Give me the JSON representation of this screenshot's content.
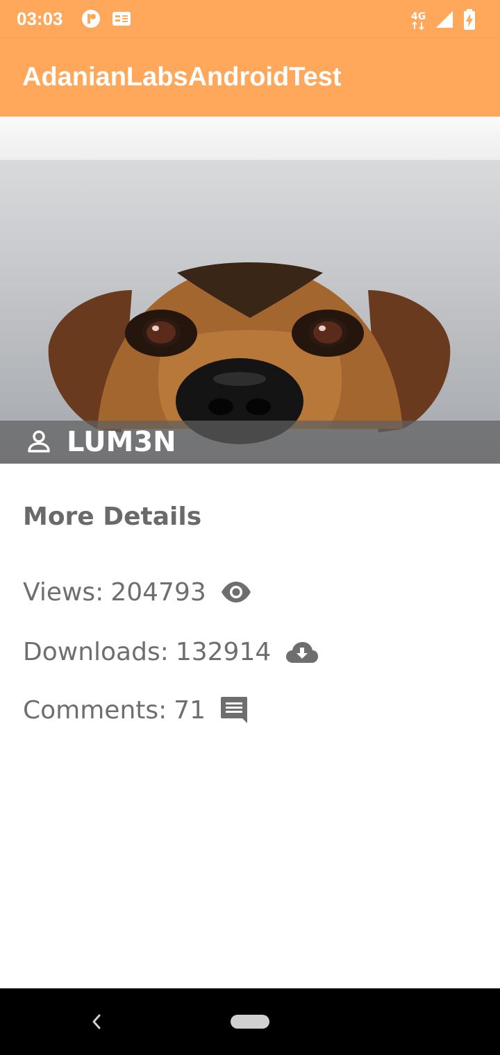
{
  "status_bar": {
    "time": "03:03",
    "network": "4G",
    "icons": [
      "pinterest-icon",
      "news-icon",
      "network-4g-icon",
      "signal-icon",
      "battery-charging-icon"
    ]
  },
  "app_bar": {
    "title": "AdanianLabsAndroidTest"
  },
  "hero": {
    "image": "dog-photo",
    "owner_icon": "person-icon",
    "owner_name": "LUM3N"
  },
  "details": {
    "heading": "More Details",
    "views_label": "Views:",
    "views_value": "204793",
    "views_icon": "eye-icon",
    "downloads_label": "Downloads:",
    "downloads_value": "132914",
    "downloads_icon": "cloud-download-icon",
    "comments_label": "Comments:",
    "comments_value": "71",
    "comments_icon": "comment-icon"
  },
  "nav_bar": {
    "icons": [
      "back-icon",
      "home-pill-icon"
    ]
  },
  "colors": {
    "accent": "#FFA75A",
    "text_secondary": "#6E6E6E",
    "nav_background": "#000000"
  }
}
